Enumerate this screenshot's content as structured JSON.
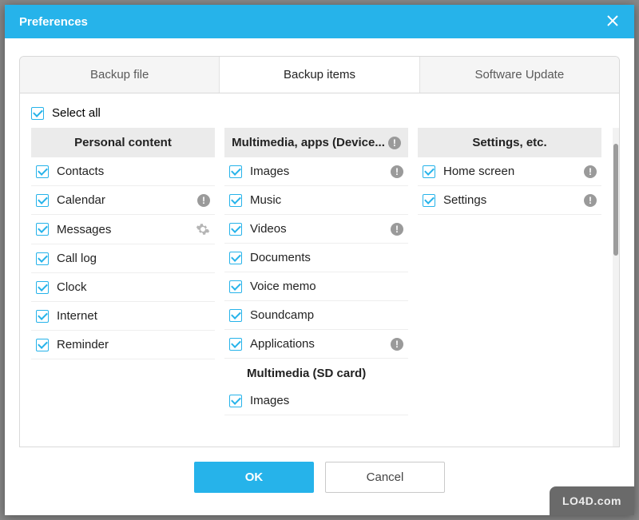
{
  "window": {
    "title": "Preferences"
  },
  "tabs": [
    {
      "label": "Backup file",
      "active": false
    },
    {
      "label": "Backup items",
      "active": true
    },
    {
      "label": "Software Update",
      "active": false
    }
  ],
  "select_all": {
    "label": "Select all",
    "checked": true
  },
  "columns": {
    "personal": {
      "header": "Personal content",
      "items": [
        {
          "label": "Contacts",
          "checked": true
        },
        {
          "label": "Calendar",
          "checked": true,
          "info": true
        },
        {
          "label": "Messages",
          "checked": true,
          "gear": true
        },
        {
          "label": "Call log",
          "checked": true
        },
        {
          "label": "Clock",
          "checked": true
        },
        {
          "label": "Internet",
          "checked": true
        },
        {
          "label": "Reminder",
          "checked": true
        }
      ]
    },
    "multimedia": {
      "header": "Multimedia, apps (Device...",
      "header_info": true,
      "items": [
        {
          "label": "Images",
          "checked": true,
          "info": true
        },
        {
          "label": "Music",
          "checked": true
        },
        {
          "label": "Videos",
          "checked": true,
          "info": true
        },
        {
          "label": "Documents",
          "checked": true
        },
        {
          "label": "Voice memo",
          "checked": true
        },
        {
          "label": "Soundcamp",
          "checked": true
        },
        {
          "label": "Applications",
          "checked": true,
          "info": true
        }
      ],
      "sub_header": "Multimedia (SD card)",
      "sub_items": [
        {
          "label": "Images",
          "checked": true
        }
      ]
    },
    "settings": {
      "header": "Settings, etc.",
      "items": [
        {
          "label": "Home screen",
          "checked": true,
          "info": true
        },
        {
          "label": "Settings",
          "checked": true,
          "info": true
        }
      ]
    }
  },
  "buttons": {
    "ok": "OK",
    "cancel": "Cancel"
  },
  "watermark": "LO4D.com"
}
